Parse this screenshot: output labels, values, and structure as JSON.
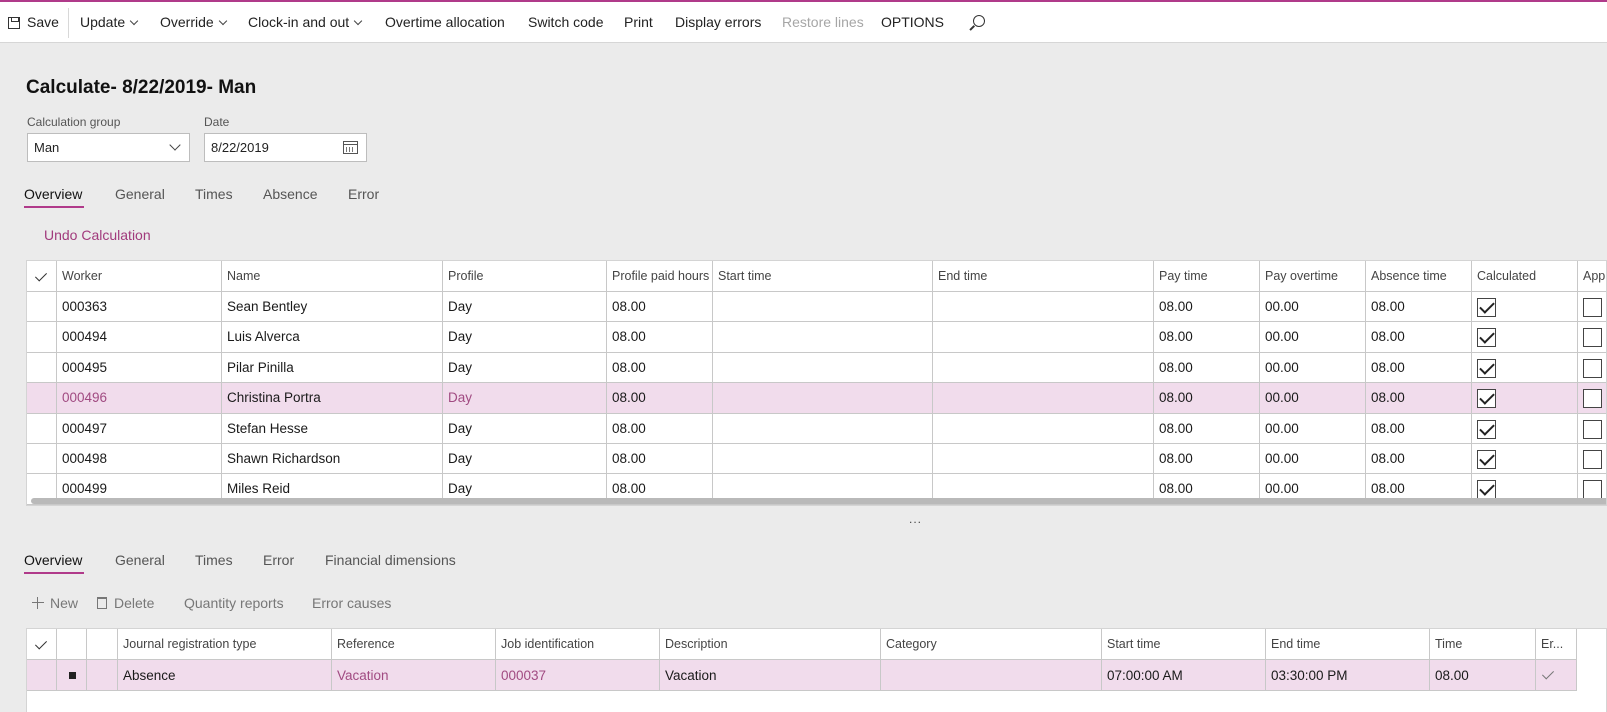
{
  "toolbar": {
    "save": "Save",
    "update": "Update",
    "override": "Override",
    "clock": "Clock-in and out",
    "overtime": "Overtime allocation",
    "switch_code": "Switch code",
    "print": "Print",
    "display_errors": "Display errors",
    "restore_lines": "Restore lines",
    "options": "OPTIONS"
  },
  "page_title": "Calculate- 8/22/2019- Man",
  "fields": {
    "calc_group_label": "Calculation group",
    "calc_group_value": "Man",
    "date_label": "Date",
    "date_value": "8/22/2019"
  },
  "upper_tabs": [
    "Overview",
    "General",
    "Times",
    "Absence",
    "Error"
  ],
  "undo": "Undo Calculation",
  "worker_grid": {
    "headers": [
      "Worker",
      "Name",
      "Profile",
      "Profile paid hours",
      "Start time",
      "End time",
      "Pay time",
      "Pay overtime",
      "Absence time",
      "Calculated",
      "App"
    ],
    "rows": [
      {
        "worker": "000363",
        "name": "Sean Bentley",
        "profile": "Day",
        "paid": "08.00",
        "start": "",
        "end": "",
        "pay": "08.00",
        "ot": "00.00",
        "absence": "08.00",
        "calculated": true,
        "approved": false
      },
      {
        "worker": "000494",
        "name": "Luis Alverca",
        "profile": "Day",
        "paid": "08.00",
        "start": "",
        "end": "",
        "pay": "08.00",
        "ot": "00.00",
        "absence": "08.00",
        "calculated": true,
        "approved": false
      },
      {
        "worker": "000495",
        "name": "Pilar Pinilla",
        "profile": "Day",
        "paid": "08.00",
        "start": "",
        "end": "",
        "pay": "08.00",
        "ot": "00.00",
        "absence": "08.00",
        "calculated": true,
        "approved": false
      },
      {
        "worker": "000496",
        "name": "Christina Portra",
        "profile": "Day",
        "paid": "08.00",
        "start": "",
        "end": "",
        "pay": "08.00",
        "ot": "00.00",
        "absence": "08.00",
        "calculated": true,
        "approved": false
      },
      {
        "worker": "000497",
        "name": "Stefan Hesse",
        "profile": "Day",
        "paid": "08.00",
        "start": "",
        "end": "",
        "pay": "08.00",
        "ot": "00.00",
        "absence": "08.00",
        "calculated": true,
        "approved": false
      },
      {
        "worker": "000498",
        "name": "Shawn Richardson",
        "profile": "Day",
        "paid": "08.00",
        "start": "",
        "end": "",
        "pay": "08.00",
        "ot": "00.00",
        "absence": "08.00",
        "calculated": true,
        "approved": false
      },
      {
        "worker": "000499",
        "name": "Miles Reid",
        "profile": "Day",
        "paid": "08.00",
        "start": "",
        "end": "",
        "pay": "08.00",
        "ot": "00.00",
        "absence": "08.00",
        "calculated": true,
        "approved": false
      }
    ]
  },
  "lower_tabs": [
    "Overview",
    "General",
    "Times",
    "Error",
    "Financial dimensions"
  ],
  "lines_toolbar": {
    "new": "New",
    "delete": "Delete",
    "quantity_reports": "Quantity reports",
    "error_causes": "Error causes"
  },
  "lines_grid": {
    "headers": [
      "Journal registration type",
      "Reference",
      "Job identification",
      "Description",
      "Category",
      "Start time",
      "End time",
      "Time",
      "Er..."
    ],
    "rows": [
      {
        "type": "Absence",
        "reference": "Vacation",
        "job": "000037",
        "description": "Vacation",
        "category": "",
        "start": "07:00:00 AM",
        "end": "03:30:00 PM",
        "time": "08.00"
      }
    ]
  }
}
